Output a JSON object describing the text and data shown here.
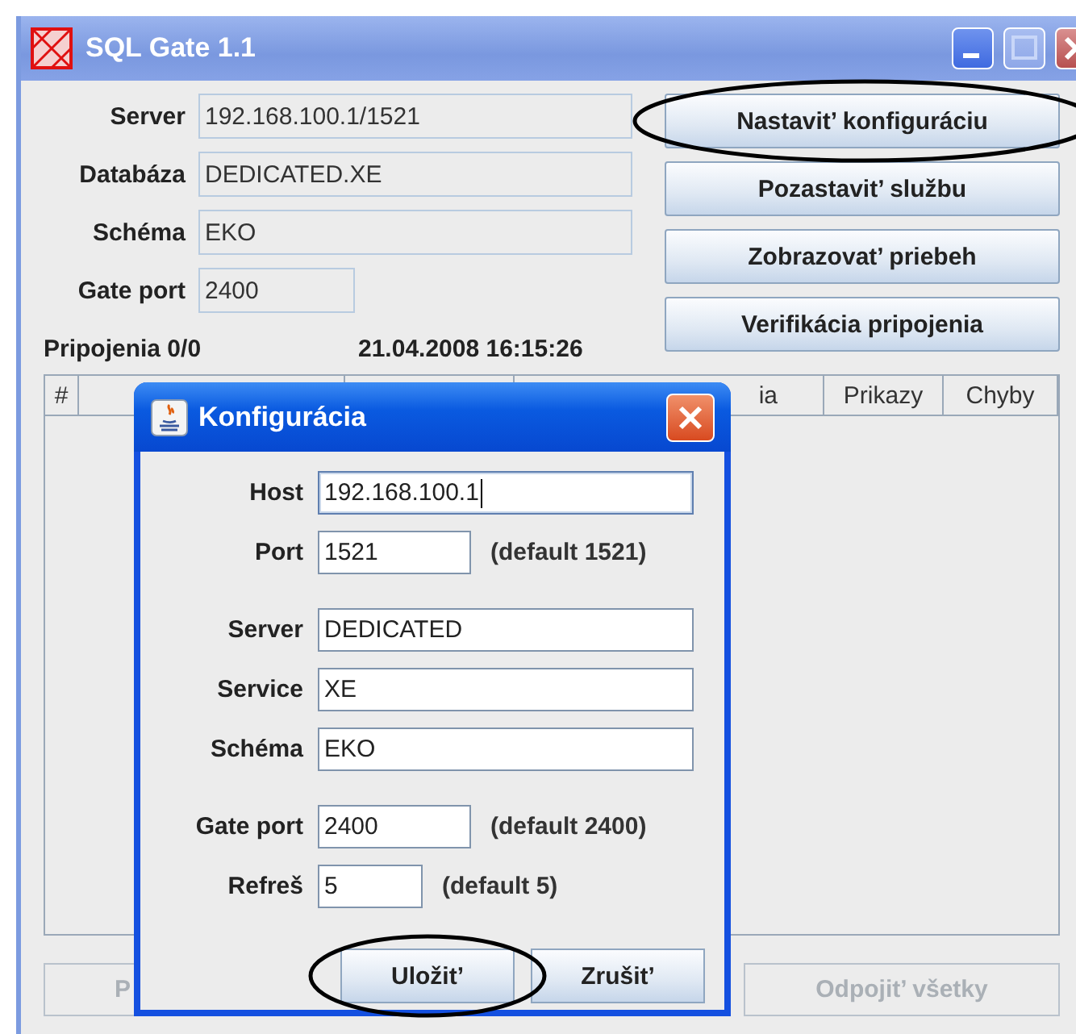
{
  "window": {
    "title": "SQL Gate 1.1"
  },
  "fields": [
    {
      "label": "Server",
      "value": "192.168.100.1/1521",
      "kind": "long"
    },
    {
      "label": "Databáza",
      "value": "DEDICATED.XE",
      "kind": "long"
    },
    {
      "label": "Schéma",
      "value": "EKO",
      "kind": "long"
    },
    {
      "label": "Gate port",
      "value": "2400",
      "kind": "short"
    }
  ],
  "buttons": [
    {
      "label": "Nastavit’ konfiguráciu",
      "highlighted": true
    },
    {
      "label": "Pozastavit’ službu",
      "highlighted": false
    },
    {
      "label": "Zobrazovat’ priebeh",
      "highlighted": false
    },
    {
      "label": "Verifikácia pripojenia",
      "highlighted": false
    }
  ],
  "status": {
    "connections": "Pripojenia 0/0",
    "datetime": "21.04.2008 16:15:26"
  },
  "table": {
    "columns": [
      "#",
      "ia",
      "Prikazy",
      "Chyby"
    ]
  },
  "bottom_buttons": [
    {
      "label": "P",
      "disabled": true
    },
    {
      "label": "Odpojit’ všetky",
      "disabled": true
    }
  ],
  "dialog": {
    "title": "Konfigurácia",
    "groups": [
      [
        {
          "label": "Host",
          "value": "192.168.100.1",
          "kind": "long",
          "focused": true
        },
        {
          "label": "Port",
          "value": "1521",
          "kind": "medium",
          "focused": false,
          "hint": "(default 1521)"
        }
      ],
      [
        {
          "label": "Server",
          "value": "DEDICATED",
          "kind": "long",
          "focused": false
        },
        {
          "label": "Service",
          "value": "XE",
          "kind": "long",
          "focused": false
        },
        {
          "label": "Schéma",
          "value": "EKO",
          "kind": "long",
          "focused": false
        }
      ],
      [
        {
          "label": "Gate port",
          "value": "2400",
          "kind": "medium",
          "focused": false,
          "hint": "(default 2400)"
        },
        {
          "label": "Refreš",
          "value": "5",
          "kind": "small",
          "focused": false,
          "hint": "(default 5)"
        }
      ]
    ],
    "buttons": [
      {
        "label": "Uložit’",
        "highlighted": true
      },
      {
        "label": "Zrušit’",
        "highlighted": false
      }
    ]
  }
}
